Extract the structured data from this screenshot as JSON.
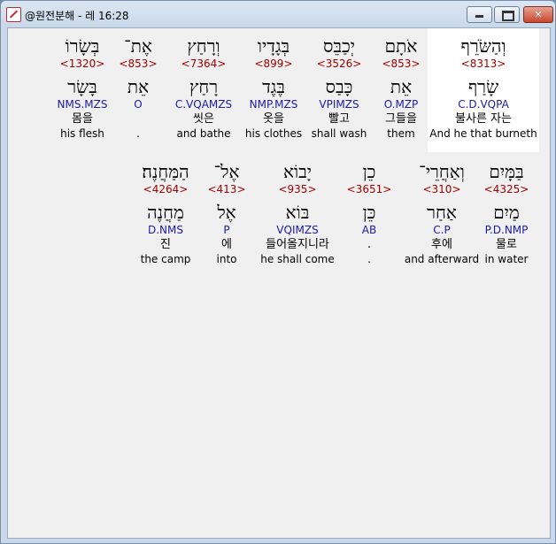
{
  "window": {
    "title": "@원전분해 - 레 16:28",
    "minimize_glyph": "",
    "maximize_glyph": "",
    "close_glyph": "✕"
  },
  "rows": [
    [
      {
        "word": "וְהַשֹּׂרֵף",
        "strong": "<8313>",
        "lemma": "שָׂרַף",
        "morph": "C.D.VQPA",
        "korean": "불사른 자는",
        "english": "And he that burneth",
        "highlight": true
      },
      {
        "word": "אֹתָם",
        "strong": "<853>",
        "lemma": "אֵת",
        "morph": "O.MZP",
        "korean": "그들을",
        "english": "them"
      },
      {
        "word": "יְכַבֵּס",
        "strong": "<3526>",
        "lemma": "כָּבַס",
        "morph": "VPIMZS",
        "korean": "빨고",
        "english": "shall wash"
      },
      {
        "word": "בְּגָדָיו",
        "strong": "<899>",
        "lemma": "בֶּגֶד",
        "morph": "NMP.MZS",
        "korean": "옷을",
        "english": "his clothes"
      },
      {
        "word": "וְרָחַץ",
        "strong": "<7364>",
        "lemma": "רָחַץ",
        "morph": "C.VQAMZS",
        "korean": "씻은",
        "english": "and bathe"
      },
      {
        "word": "אֶת־",
        "strong": "<853>",
        "lemma": "אֵת",
        "morph": "O",
        "korean": "",
        "english": "."
      },
      {
        "word": "בְּשָׂרוֹ",
        "strong": "<1320>",
        "lemma": "בָּשָׂר",
        "morph": "NMS.MZS",
        "korean": "몸을",
        "english": "his flesh"
      }
    ],
    [
      {
        "word": "בַּמָּיִם",
        "strong": "<4325>",
        "lemma": "מַיִם",
        "morph": "P.D.NMP",
        "korean": "물로",
        "english": "in water"
      },
      {
        "word": "וְאַחֲרֵי־",
        "strong": "<310>",
        "lemma": "אַחַר",
        "morph": "C.P",
        "korean": "후에",
        "english": "and afterward"
      },
      {
        "word": "כֵן",
        "strong": "<3651>",
        "lemma": "כֵּן",
        "morph": "AB",
        "korean": ".",
        "english": "."
      },
      {
        "word": "יָבוֹא",
        "strong": "<935>",
        "lemma": "בּוֹא",
        "morph": "VQIMZS",
        "korean": "들어올지니라",
        "english": "he shall come"
      },
      {
        "word": "אֶל־",
        "strong": "<413>",
        "lemma": "אֶל",
        "morph": "P",
        "korean": "에",
        "english": "into"
      },
      {
        "word": "הַמַּחֲנֶה׃",
        "strong": "<4264>",
        "lemma": "מַחֲנֶה",
        "morph": "D.NMS",
        "korean": "진",
        "english": "the camp"
      }
    ]
  ]
}
